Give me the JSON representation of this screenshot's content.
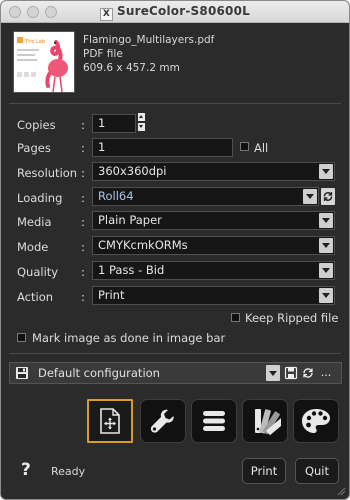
{
  "window": {
    "title": "SureColor-S80600L",
    "app_icon_glyph": "X"
  },
  "file": {
    "name": "Flamingo_Multilayers.pdf",
    "type": "PDF file",
    "size": "609.6 x 457.2 mm",
    "thumb_brand": "Tire Lab"
  },
  "form": {
    "copies": {
      "label": "Copies",
      "value": "1"
    },
    "pages": {
      "label": "Pages",
      "value": "1",
      "all_label": "All"
    },
    "resolution": {
      "label": "Resolution",
      "value": "360x360dpi"
    },
    "loading": {
      "label": "Loading",
      "value": "Roll64"
    },
    "media": {
      "label": "Media",
      "value": "Plain Paper"
    },
    "mode": {
      "label": "Mode",
      "value": "CMYKcmkORMs"
    },
    "quality": {
      "label": "Quality",
      "value": "1 Pass - Bid"
    },
    "action": {
      "label": "Action",
      "value": "Print"
    },
    "colon": ":",
    "keep_ripped_label": "Keep Ripped file",
    "mark_image_label": "Mark image as done in image bar"
  },
  "config": {
    "value": "Default configuration",
    "more_label": "..."
  },
  "tools": [
    {
      "icon": "layout-move-icon",
      "active": true
    },
    {
      "icon": "wrench-icon",
      "active": false
    },
    {
      "icon": "list-icon",
      "active": false
    },
    {
      "icon": "swatches-icon",
      "active": false
    },
    {
      "icon": "palette-icon",
      "active": false
    }
  ],
  "footer": {
    "help_label": "?",
    "status": "Ready",
    "print_label": "Print",
    "quit_label": "Quit"
  },
  "colors": {
    "accent": "#d99a28",
    "panel": "#2b2b2b",
    "field": "#161616"
  }
}
